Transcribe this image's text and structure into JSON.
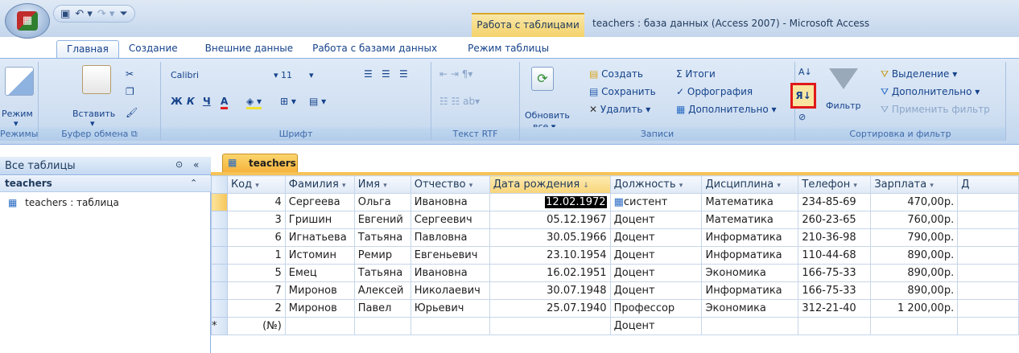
{
  "window": {
    "title": "teachers : база данных (Access 2007) - Microsoft Access",
    "contextual_tab_group": "Работа с таблицами"
  },
  "tabs": [
    "Главная",
    "Создание",
    "Внешние данные",
    "Работа с базами данных",
    "Режим таблицы"
  ],
  "ribbon": {
    "groups": {
      "views": "Режимы",
      "clipboard": "Буфер обмена",
      "font": "Шрифт",
      "rtf": "Текст RTF",
      "records": "Записи",
      "sort_filter": "Сортировка и фильтр"
    },
    "mode_label": "Режим",
    "paste_label": "Вставить",
    "font_name": "Calibri",
    "font_size": "11",
    "refresh_label": "Обновить",
    "refresh_sub": "все ▾",
    "records": {
      "create": "Создать",
      "save": "Сохранить",
      "delete": "Удалить ▾",
      "totals": "Итоги",
      "spelling": "Орфография",
      "more": "Дополнительно ▾"
    },
    "sort": {
      "filter": "Фильтр",
      "selection": "Выделение ▾",
      "advanced": "Дополнительно ▾",
      "apply": "Применить фильтр"
    },
    "font_buttons": {
      "bold": "Ж",
      "italic": "К",
      "underline": "Ч",
      "color": "A"
    }
  },
  "nav": {
    "header": "Все таблицы",
    "group": "teachers",
    "item": "teachers : таблица"
  },
  "document_tab": "teachers",
  "table": {
    "columns": [
      "Код",
      "Фамилия",
      "Имя",
      "Отчество",
      "Дата рождения",
      "Должность",
      "Дисциплина",
      "Телефон",
      "Зарплата",
      "Д"
    ],
    "rows": [
      [
        "4",
        "Сергеева",
        "Ольга",
        "Ивановна",
        "12.02.1972",
        "систент",
        "Математика",
        "234-85-69",
        "470,00р."
      ],
      [
        "3",
        "Гришин",
        "Евгений",
        "Сергеевич",
        "05.12.1967",
        "Доцент",
        "Математика",
        "260-23-65",
        "760,00р."
      ],
      [
        "6",
        "Игнатьева",
        "Татьяна",
        "Павловна",
        "30.05.1966",
        "Доцент",
        "Информатика",
        "210-36-98",
        "790,00р."
      ],
      [
        "1",
        "Истомин",
        "Ремир",
        "Евгеньевич",
        "23.10.1954",
        "Доцент",
        "Информатика",
        "110-44-68",
        "890,00р."
      ],
      [
        "5",
        "Емец",
        "Татьяна",
        "Ивановна",
        "16.02.1951",
        "Доцент",
        "Экономика",
        "166-75-33",
        "890,00р."
      ],
      [
        "7",
        "Миронов",
        "Алексей",
        "Николаевич",
        "30.07.1948",
        "Доцент",
        "Информатика",
        "166-75-33",
        "890,00р."
      ],
      [
        "2",
        "Миронов",
        "Павел",
        "Юрьевич",
        "25.07.1940",
        "Профессор",
        "Экономика",
        "312-21-40",
        "1 200,00р."
      ]
    ],
    "new_row": {
      "marker": "*",
      "code": "(№)",
      "position": "Доцент"
    }
  }
}
